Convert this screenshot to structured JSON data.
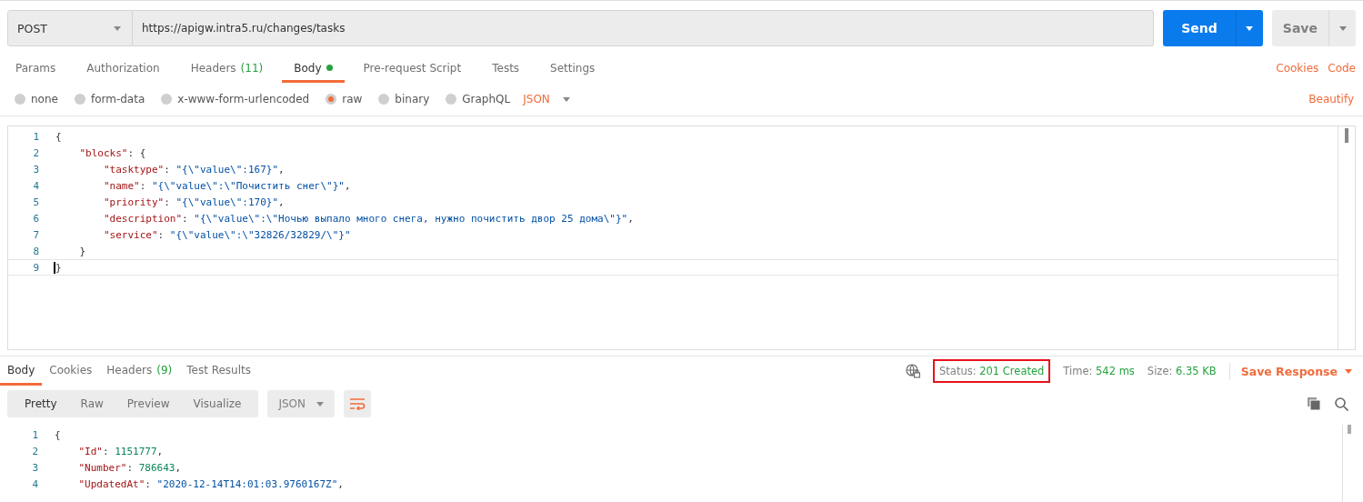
{
  "request": {
    "method": "POST",
    "url": "https://apigw.intra5.ru/changes/tasks",
    "send": "Send",
    "save": "Save"
  },
  "request_tabs": [
    {
      "label": "Params",
      "selected": false
    },
    {
      "label": "Authorization",
      "selected": false
    },
    {
      "label": "Headers",
      "count": "(11)",
      "selected": false
    },
    {
      "label": "Body",
      "dot": true,
      "selected": true
    },
    {
      "label": "Pre-request Script",
      "selected": false
    },
    {
      "label": "Tests",
      "selected": false
    },
    {
      "label": "Settings",
      "selected": false
    }
  ],
  "request_links": [
    "Cookies",
    "Code"
  ],
  "body_types": [
    {
      "label": "none",
      "selected": false
    },
    {
      "label": "form-data",
      "selected": false
    },
    {
      "label": "x-www-form-urlencoded",
      "selected": false
    },
    {
      "label": "raw",
      "selected": true
    },
    {
      "label": "binary",
      "selected": false
    },
    {
      "label": "GraphQL",
      "selected": false
    }
  ],
  "body_format": "JSON",
  "beautify": "Beautify",
  "request_body": [
    {
      "number": "1",
      "active": false,
      "tokens": [
        {
          "kind": "punct",
          "text": "{"
        }
      ]
    },
    {
      "number": "2",
      "active": false,
      "tokens": [
        {
          "kind": "key",
          "text": "    \"blocks\""
        },
        {
          "kind": "punct",
          "text": ": {"
        }
      ]
    },
    {
      "number": "3",
      "active": false,
      "tokens": [
        {
          "kind": "key",
          "text": "        \"tasktype\""
        },
        {
          "kind": "punct",
          "text": ": "
        },
        {
          "kind": "string",
          "text": "\"{\\\"value\\\":167}\""
        },
        {
          "kind": "punct",
          "text": ","
        }
      ]
    },
    {
      "number": "4",
      "active": false,
      "tokens": [
        {
          "kind": "key",
          "text": "        \"name\""
        },
        {
          "kind": "punct",
          "text": ": "
        },
        {
          "kind": "string",
          "text": "\"{\\\"value\\\":\\\"Почистить снег\\\"}\""
        },
        {
          "kind": "punct",
          "text": ","
        }
      ]
    },
    {
      "number": "5",
      "active": false,
      "tokens": [
        {
          "kind": "key",
          "text": "        \"priority\""
        },
        {
          "kind": "punct",
          "text": ": "
        },
        {
          "kind": "string",
          "text": "\"{\\\"value\\\":170}\""
        },
        {
          "kind": "punct",
          "text": ","
        }
      ]
    },
    {
      "number": "6",
      "active": false,
      "tokens": [
        {
          "kind": "key",
          "text": "        \"description\""
        },
        {
          "kind": "punct",
          "text": ": "
        },
        {
          "kind": "string",
          "text": "\"{\\\"value\\\":\\\"Ночью выпало много снега, нужно почистить двор 25 дома\\\"}\""
        },
        {
          "kind": "punct",
          "text": ","
        }
      ]
    },
    {
      "number": "7",
      "active": false,
      "tokens": [
        {
          "kind": "key",
          "text": "        \"service\""
        },
        {
          "kind": "punct",
          "text": ": "
        },
        {
          "kind": "string",
          "text": "\"{\\\"value\\\":\\\"32826/32829/\\\"}\""
        }
      ]
    },
    {
      "number": "8",
      "active": false,
      "tokens": [
        {
          "kind": "punct",
          "text": "    }"
        }
      ]
    },
    {
      "number": "9",
      "active": true,
      "tokens": [
        {
          "kind": "punct",
          "text": "}"
        }
      ]
    }
  ],
  "response_tabs": [
    {
      "label": "Body",
      "selected": true
    },
    {
      "label": "Cookies",
      "selected": false
    },
    {
      "label": "Headers",
      "count": "(9)",
      "selected": false
    },
    {
      "label": "Test Results",
      "selected": false
    }
  ],
  "response_meta": {
    "status_label": "Status:",
    "status": "201 Created",
    "status_highlighted": true,
    "time_label": "Time:",
    "time": "542 ms",
    "size_label": "Size:",
    "size": "6.35 KB",
    "save_response": "Save Response"
  },
  "view_modes": [
    {
      "label": "Pretty",
      "selected": true
    },
    {
      "label": "Raw",
      "selected": false
    },
    {
      "label": "Preview",
      "selected": false
    },
    {
      "label": "Visualize",
      "selected": false
    }
  ],
  "response_format": "JSON",
  "response_body": [
    {
      "number": "1",
      "tokens": [
        {
          "kind": "punct",
          "text": "{"
        }
      ]
    },
    {
      "number": "2",
      "tokens": [
        {
          "kind": "key",
          "text": "    \"Id\""
        },
        {
          "kind": "punct",
          "text": ": "
        },
        {
          "kind": "number",
          "text": "1151777"
        },
        {
          "kind": "punct",
          "text": ","
        }
      ]
    },
    {
      "number": "3",
      "tokens": [
        {
          "kind": "key",
          "text": "    \"Number\""
        },
        {
          "kind": "punct",
          "text": ": "
        },
        {
          "kind": "number",
          "text": "786643"
        },
        {
          "kind": "punct",
          "text": ","
        }
      ]
    },
    {
      "number": "4",
      "tokens": [
        {
          "kind": "key",
          "text": "    \"UpdatedAt\""
        },
        {
          "kind": "punct",
          "text": ": "
        },
        {
          "kind": "string",
          "text": "\"2020-12-14T14:01:03.9760167Z\""
        },
        {
          "kind": "punct",
          "text": ","
        }
      ]
    }
  ]
}
